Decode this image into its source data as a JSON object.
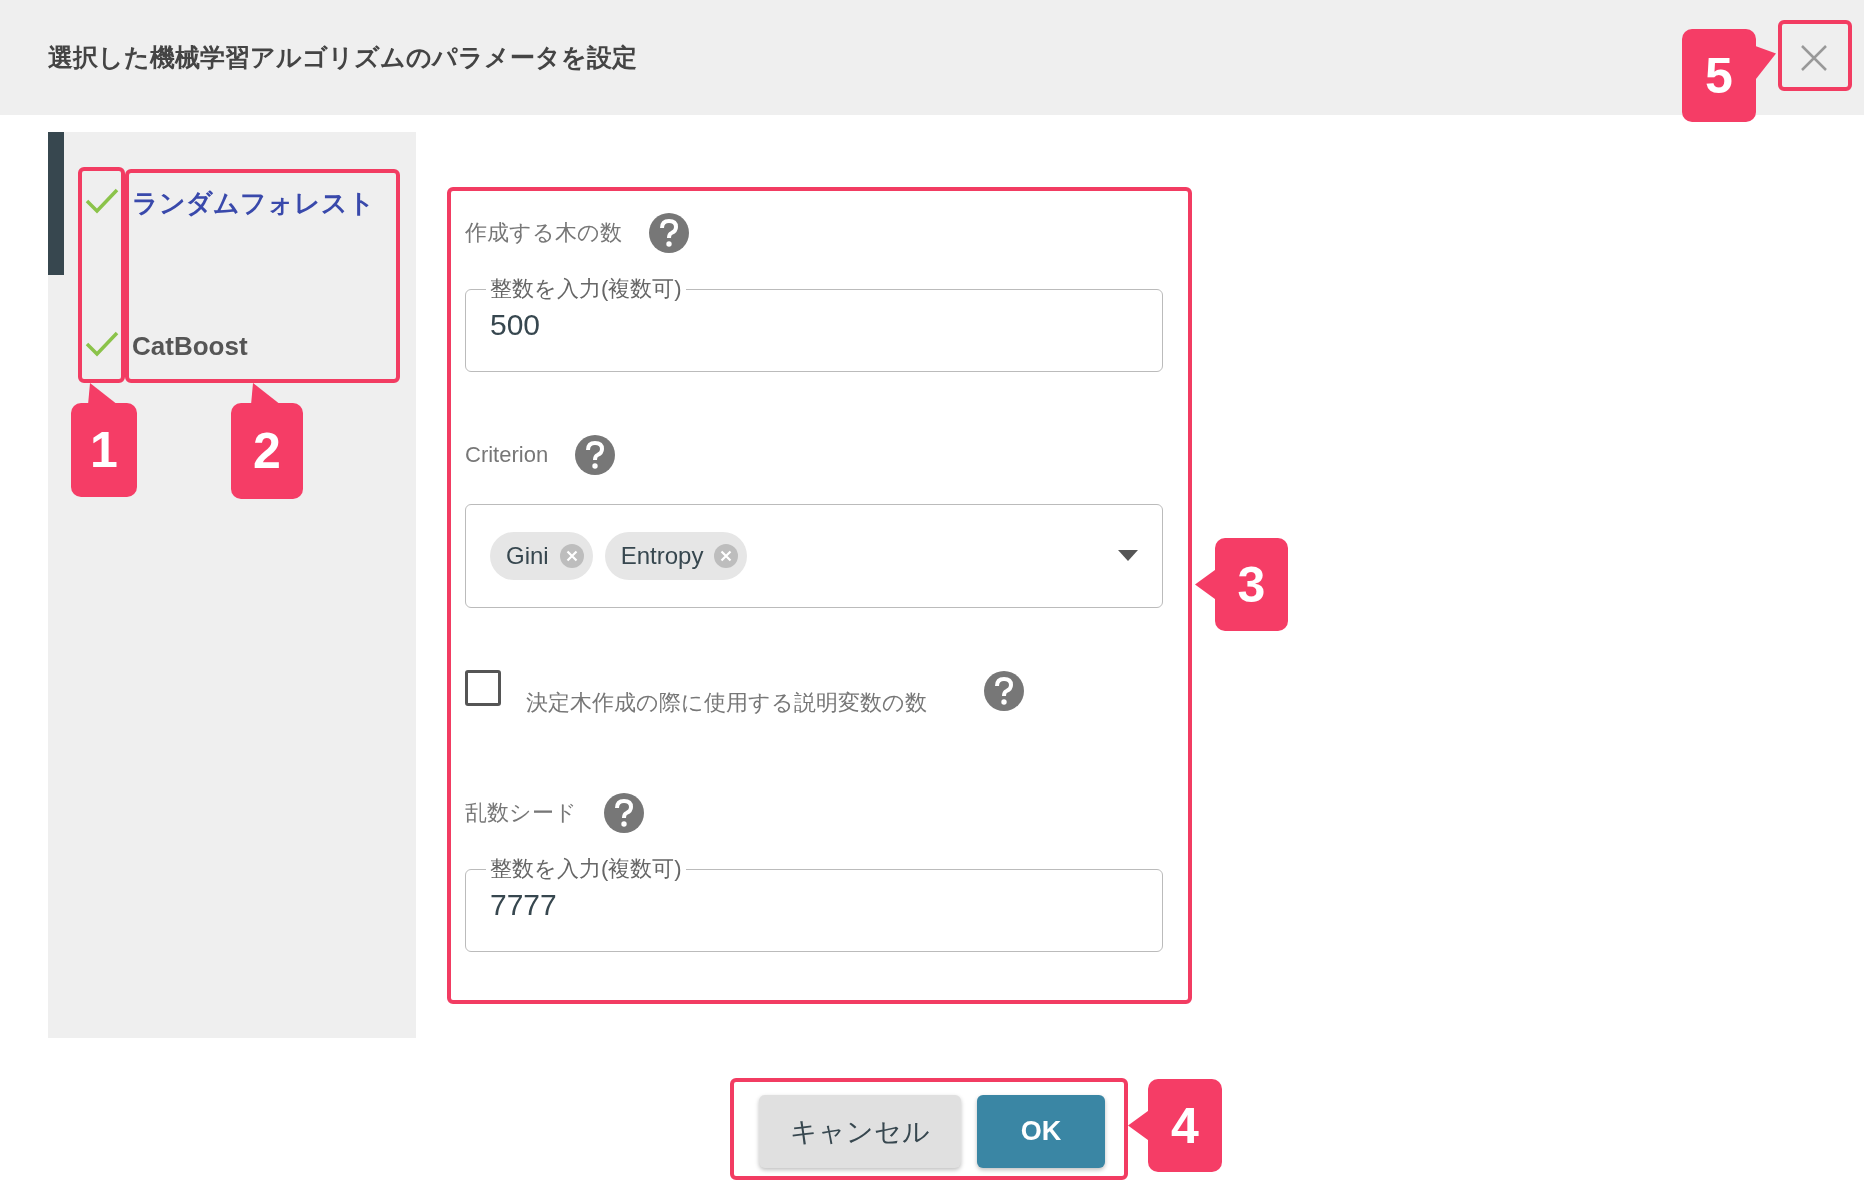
{
  "dialog": {
    "title": "選択した機械学習アルゴリズムのパラメータを設定"
  },
  "sidebar": {
    "items": [
      {
        "label": "ランダムフォレスト",
        "selected": true,
        "checked": true
      },
      {
        "label": "CatBoost",
        "selected": false,
        "checked": true
      }
    ]
  },
  "form": {
    "fields": [
      {
        "kind": "number",
        "label": "作成する木の数",
        "field_label": "整数を入力(複数可)",
        "value": "500"
      },
      {
        "kind": "multiselect",
        "label": "Criterion",
        "chips": [
          "Gini",
          "Entropy"
        ]
      },
      {
        "kind": "checkbox",
        "label": "決定木作成の際に使用する説明変数の数",
        "checked": false
      },
      {
        "kind": "number",
        "label": "乱数シード",
        "field_label": "整数を入力(複数可)",
        "value": "7777"
      }
    ]
  },
  "buttons": [
    {
      "label": "キャンセル",
      "kind": "secondary"
    },
    {
      "label": "OK",
      "kind": "primary"
    }
  ],
  "annotations": [
    {
      "number": "1"
    },
    {
      "number": "2"
    },
    {
      "number": "3"
    },
    {
      "number": "4"
    },
    {
      "number": "5"
    }
  ]
}
